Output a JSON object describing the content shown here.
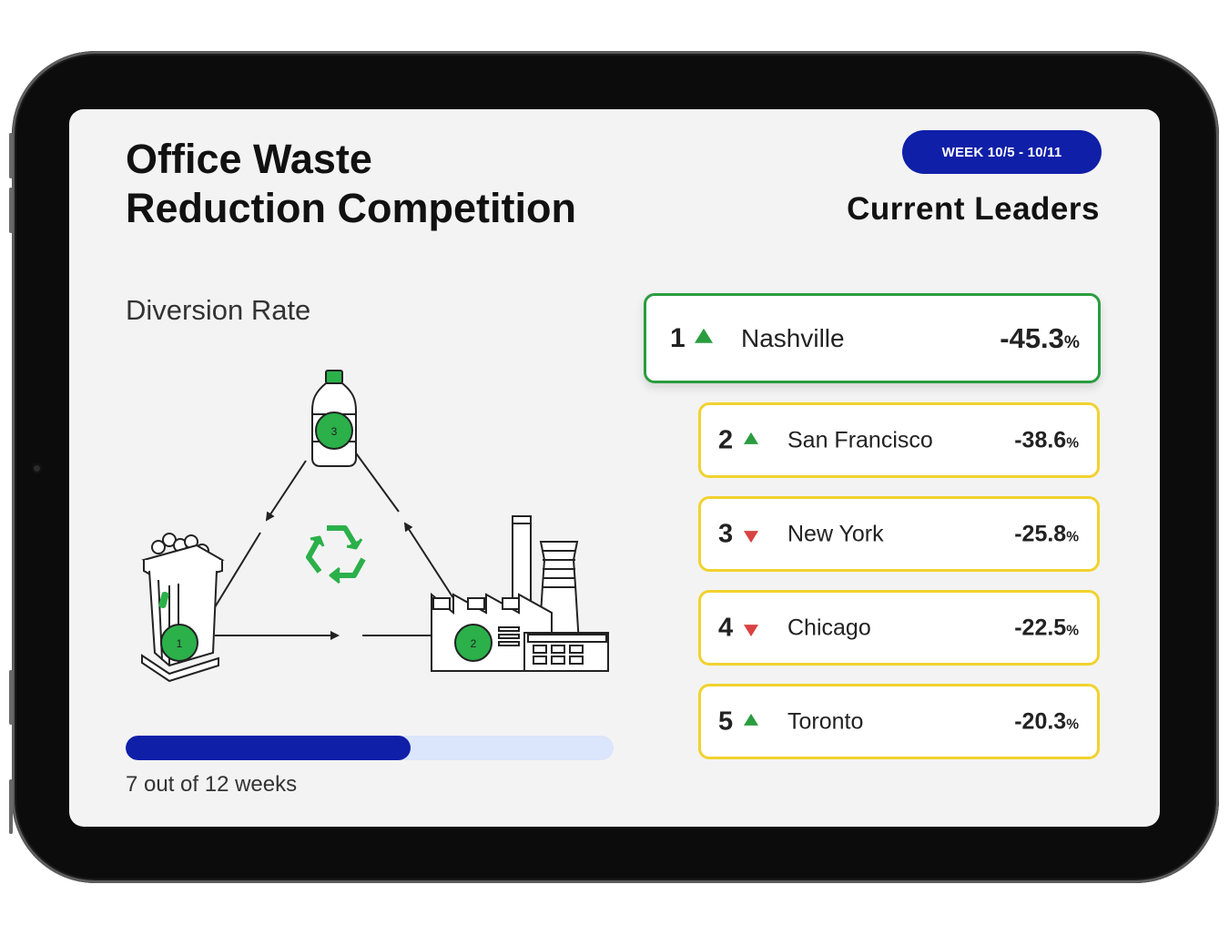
{
  "header": {
    "title_line1": "Office Waste",
    "title_line2": "Reduction Competition",
    "week_badge": "WEEK 10/5 - 10/11",
    "leaders_title": "Current Leaders"
  },
  "diversion": {
    "label": "Diversion Rate",
    "step_labels": [
      "1",
      "2",
      "3"
    ],
    "progress": {
      "completed_weeks": 7,
      "total_weeks": 12,
      "label": "7 out of 12 weeks"
    }
  },
  "leaders": [
    {
      "rank": "1",
      "trend": "up",
      "city": "Nashville",
      "value": "-45.3",
      "unit": "%"
    },
    {
      "rank": "2",
      "trend": "up",
      "city": "San Francisco",
      "value": "-38.6",
      "unit": "%"
    },
    {
      "rank": "3",
      "trend": "down",
      "city": "New York",
      "value": "-25.8",
      "unit": "%"
    },
    {
      "rank": "4",
      "trend": "down",
      "city": "Chicago",
      "value": "-22.5",
      "unit": "%"
    },
    {
      "rank": "5",
      "trend": "up",
      "city": "Toronto",
      "value": "-20.3",
      "unit": "%"
    }
  ],
  "colors": {
    "accent_blue": "#0f1fa8",
    "progress_track": "#dbe5fb",
    "leader_border": "#2a9d3f",
    "card_border": "#f1d22e",
    "trend_up": "#2a9d3f",
    "trend_down": "#d94242",
    "recycle_green": "#2bb04a"
  },
  "icons": [
    "bottle-icon",
    "trash-bin-icon",
    "factory-icon",
    "recycle-icon",
    "trend-up-icon",
    "trend-down-icon"
  ]
}
